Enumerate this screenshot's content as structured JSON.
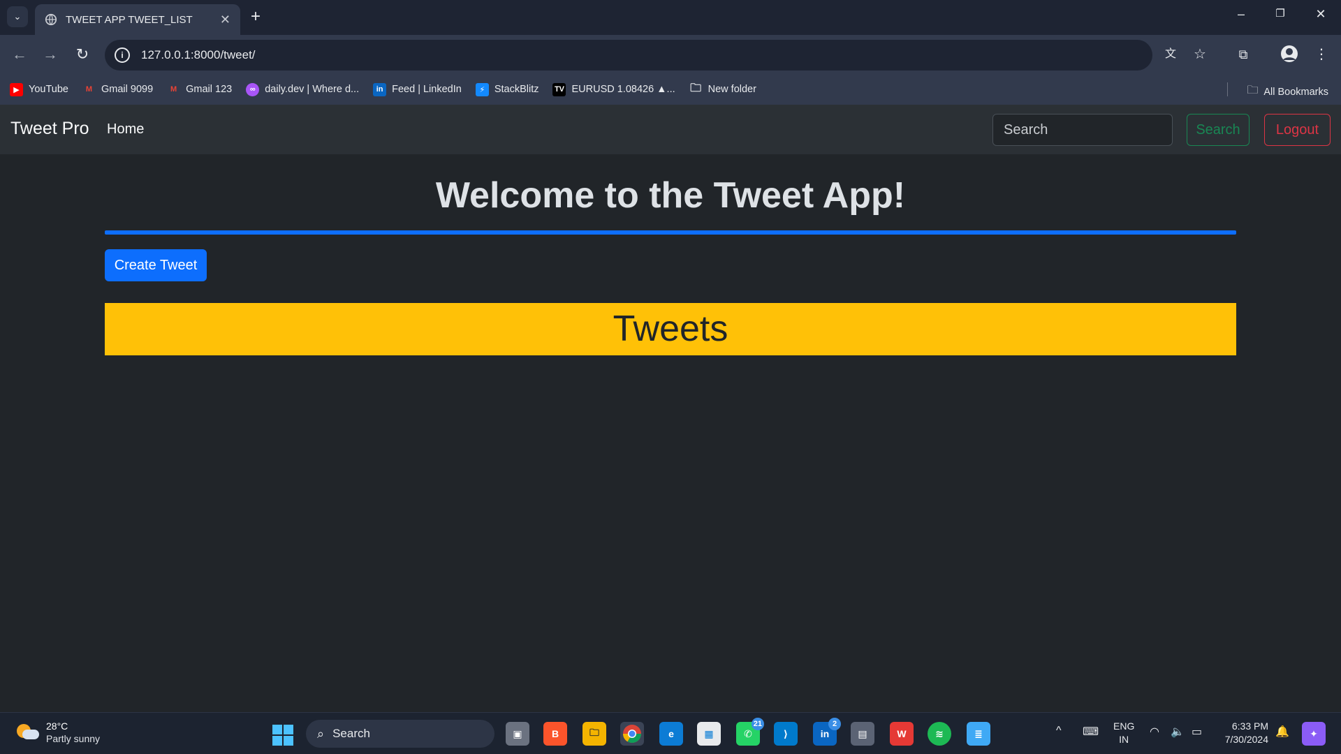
{
  "browser": {
    "tab_title": "TWEET APP TWEET_LIST",
    "url": "127.0.0.1:8000/tweet/",
    "bookmarks": [
      {
        "label": "YouTube",
        "icon": "youtube-icon",
        "color": "#ff0000"
      },
      {
        "label": "Gmail 9099",
        "icon": "gmail-icon",
        "color": "#ea4335"
      },
      {
        "label": "Gmail 123",
        "icon": "gmail-icon",
        "color": "#ea4335"
      },
      {
        "label": "daily.dev | Where d...",
        "icon": "dailydev-icon",
        "color": "#a855f7"
      },
      {
        "label": "Feed | LinkedIn",
        "icon": "linkedin-icon",
        "color": "#0a66c2"
      },
      {
        "label": "StackBlitz",
        "icon": "stackblitz-icon",
        "color": "#1389fd"
      },
      {
        "label": "EURUSD 1.08426 ▲...",
        "icon": "tradingview-icon",
        "color": "#000000"
      },
      {
        "label": "New folder",
        "icon": "folder-icon",
        "color": "#e8eaed"
      }
    ],
    "all_bookmarks_label": "All Bookmarks"
  },
  "navbar": {
    "brand": "Tweet Pro",
    "home_link": "Home",
    "search_placeholder": "Search",
    "search_button": "Search",
    "logout_button": "Logout"
  },
  "main": {
    "heading": "Welcome to the Tweet App!",
    "create_button": "Create Tweet",
    "tweets_banner": "Tweets"
  },
  "taskbar": {
    "weather_temp": "28°C",
    "weather_condition": "Partly sunny",
    "search_label": "Search",
    "whatsapp_badge": "21",
    "linkedin_badge": "2",
    "lang_line1": "ENG",
    "lang_line2": "IN",
    "time": "6:33 PM",
    "date": "7/30/2024"
  },
  "colors": {
    "primary": "#0d6efd",
    "success": "#198754",
    "danger": "#dc3545",
    "warning": "#ffc107",
    "page_bg": "#212529"
  }
}
